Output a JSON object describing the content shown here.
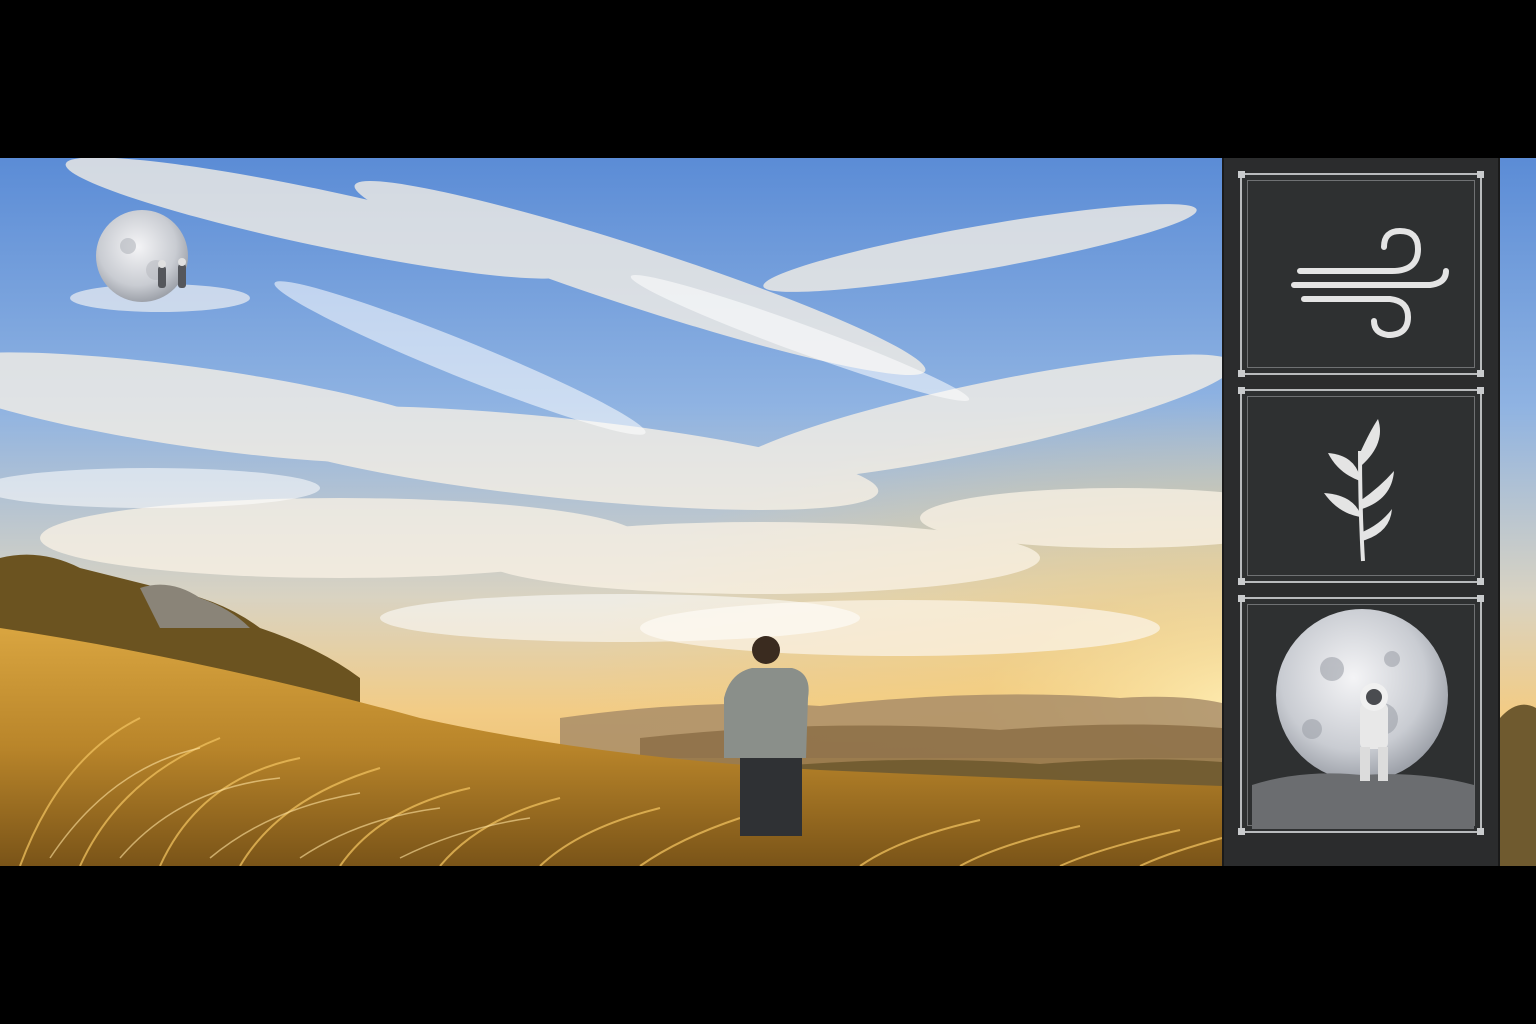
{
  "image": {
    "palette": {
      "sky_top": "#5e8fd8",
      "sky_mid": "#a9c3e6",
      "horizon": "#f3cf8a",
      "grass": "#c8932e",
      "panel_bg": "#2e3031",
      "panel_border": "#b9bbbd",
      "icon_fill": "#e4e4e4"
    }
  },
  "sidebar": {
    "panels": [
      {
        "icon": "wind-icon"
      },
      {
        "icon": "leaf-branch-icon"
      },
      {
        "icon": "moon-astronaut-icon"
      }
    ]
  }
}
